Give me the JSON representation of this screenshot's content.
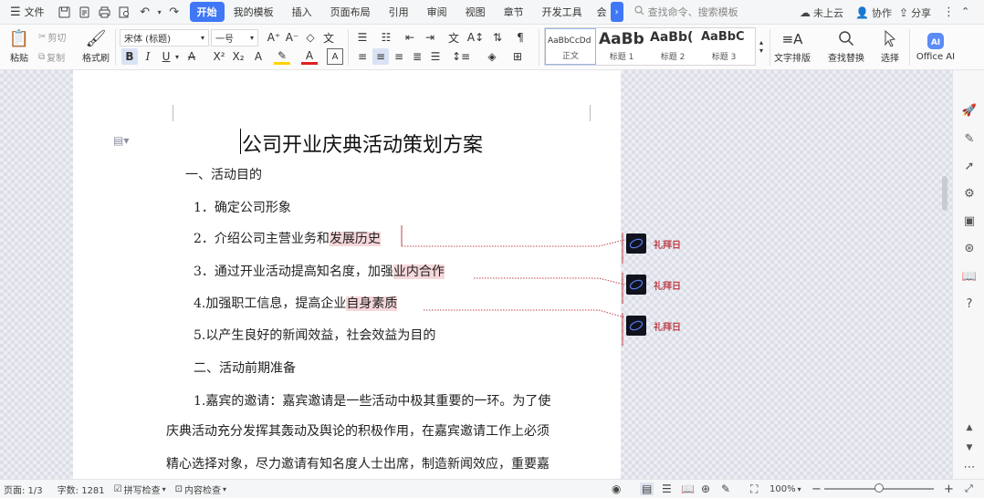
{
  "menubar": {
    "file_label": "文件",
    "tabs": [
      "开始",
      "我的模板",
      "插入",
      "页面布局",
      "引用",
      "审阅",
      "视图",
      "章节",
      "开发工具",
      "会"
    ],
    "active_tab": "开始",
    "search_placeholder": "查找命令、搜索模板",
    "cloud_label": "未上云",
    "collab_label": "协作",
    "share_label": "分享"
  },
  "ribbon": {
    "paste_label": "粘贴",
    "cut_label": "剪切",
    "copy_label": "复制",
    "format_painter_label": "格式刷",
    "font_name": "宋体 (标题)",
    "font_size": "一号",
    "styles": [
      {
        "preview": "AaBbCcDd",
        "name": "正文"
      },
      {
        "preview": "AaBb",
        "name": "标题 1"
      },
      {
        "preview": "AaBb(",
        "name": "标题 2"
      },
      {
        "preview": "AaBbC",
        "name": "标题 3"
      }
    ],
    "text_layout_label": "文字排版",
    "find_replace_label": "查找替换",
    "select_label": "选择",
    "office_ai_label": "Office AI"
  },
  "document": {
    "title": "公司开业庆典活动策划方案",
    "lines": [
      {
        "parts": [
          {
            "text": "一、活动目的"
          }
        ]
      },
      {
        "parts": [
          {
            "text": "1．确定公司形象"
          }
        ]
      },
      {
        "parts": [
          {
            "text": "2．介绍公司主营业务和"
          },
          {
            "text": "发展历史",
            "hl": true
          }
        ]
      },
      {
        "parts": [
          {
            "text": "3．通过开业活动提高知名度，加强"
          },
          {
            "text": "业内合作",
            "hl": true
          }
        ]
      },
      {
        "parts": [
          {
            "text": "4.加强职工信息，提高企业"
          },
          {
            "text": "自身素质",
            "hl": true
          }
        ]
      },
      {
        "parts": [
          {
            "text": "5.以产生良好的新闻效益，社会效益为目的"
          }
        ]
      },
      {
        "parts": [
          {
            "text": "二、活动前期准备"
          }
        ]
      },
      {
        "parts": [
          {
            "text": "1.嘉宾的邀请：嘉宾邀请是一些活动中极其重要的一环。为了使"
          }
        ]
      },
      {
        "parts": [
          {
            "text": "庆典活动充分发挥其轰动及舆论的积极作用，在嘉宾邀请工作上必须"
          }
        ]
      },
      {
        "parts": [
          {
            "text": "精心选择对象，尽力邀请有知名度人士出席，制造新闻效应，重要嘉"
          }
        ]
      }
    ],
    "comments": [
      {
        "author": "礼拜日"
      },
      {
        "author": "礼拜日"
      },
      {
        "author": "礼拜日"
      }
    ]
  },
  "statusbar": {
    "page": "页面: 1/3",
    "words": "字数: 1281",
    "spellcheck": "拼写检查",
    "content_check": "内容检查",
    "zoom": "100%"
  },
  "colors": {
    "accent": "#3f77f6",
    "highlight": "#f6d7da",
    "comment_author": "#c0404a",
    "comment_line": "#c0404a"
  }
}
